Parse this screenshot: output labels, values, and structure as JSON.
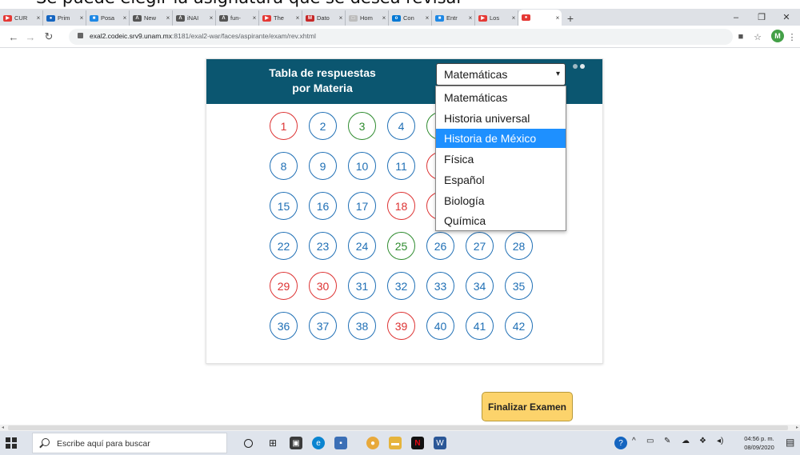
{
  "caption": {
    "bullet": "•",
    "text": "Se puede elegir la asignatura que se desea revisar"
  },
  "browser": {
    "tabs": [
      {
        "label": "CUR",
        "color": "#e53935",
        "glyph": "▶",
        "active": false
      },
      {
        "label": "Prim",
        "color": "#1565c0",
        "glyph": "●",
        "active": false
      },
      {
        "label": "Posa",
        "color": "#1e88e5",
        "glyph": "■",
        "active": false
      },
      {
        "label": "New",
        "color": "#555555",
        "glyph": "Λ",
        "active": false
      },
      {
        "label": "iNAI",
        "color": "#555555",
        "glyph": "Λ",
        "active": false
      },
      {
        "label": "fun-",
        "color": "#555555",
        "glyph": "Λ",
        "active": false
      },
      {
        "label": "The",
        "color": "#e53935",
        "glyph": "▶",
        "active": false
      },
      {
        "label": "Dato",
        "color": "#c62828",
        "glyph": "M",
        "active": false
      },
      {
        "label": "Hom",
        "color": "#bdbdbd",
        "glyph": "□",
        "active": false
      },
      {
        "label": "Con",
        "color": "#0078d4",
        "glyph": "o",
        "active": false
      },
      {
        "label": "Entr",
        "color": "#1e88e5",
        "glyph": "■",
        "active": false
      },
      {
        "label": "Los",
        "color": "#e53935",
        "glyph": "▶",
        "active": false
      },
      {
        "label": "",
        "color": "#e53935",
        "glyph": "●",
        "active": true
      }
    ],
    "tab_close": "×",
    "new_tab": "+",
    "minimize": "–",
    "maximize": "❐",
    "close": "✕",
    "url_host": "exal2.codeic.srv9.unam.mx",
    "url_rest": ":8181/exal2-war/faces/aspirante/exam/rev.xhtml",
    "profile_initial": "M"
  },
  "exam": {
    "title_line1": "Tabla de respuestas",
    "title_line2": "por Materia",
    "selected_subject": "Matemáticas",
    "dropdown_options": [
      "Matemáticas",
      "Historia universal",
      "Historia de México",
      "Física",
      "Español",
      "Biología",
      "Química"
    ],
    "highlighted_option_index": 2,
    "questions": [
      {
        "n": "1",
        "status": "red"
      },
      {
        "n": "2",
        "status": "blue"
      },
      {
        "n": "3",
        "status": "green"
      },
      {
        "n": "4",
        "status": "blue"
      },
      {
        "n": "8",
        "status": "blue"
      },
      {
        "n": "9",
        "status": "blue"
      },
      {
        "n": "10",
        "status": "blue"
      },
      {
        "n": "11",
        "status": "blue"
      },
      {
        "n": "15",
        "status": "blue"
      },
      {
        "n": "16",
        "status": "blue"
      },
      {
        "n": "17",
        "status": "blue"
      },
      {
        "n": "18",
        "status": "red"
      },
      {
        "n": "22",
        "status": "blue"
      },
      {
        "n": "23",
        "status": "blue"
      },
      {
        "n": "24",
        "status": "blue"
      },
      {
        "n": "25",
        "status": "green"
      },
      {
        "n": "26",
        "status": "blue"
      },
      {
        "n": "27",
        "status": "blue"
      },
      {
        "n": "28",
        "status": "blue"
      },
      {
        "n": "29",
        "status": "red"
      },
      {
        "n": "30",
        "status": "red"
      },
      {
        "n": "31",
        "status": "blue"
      },
      {
        "n": "32",
        "status": "blue"
      },
      {
        "n": "33",
        "status": "blue"
      },
      {
        "n": "34",
        "status": "blue"
      },
      {
        "n": "35",
        "status": "blue"
      },
      {
        "n": "36",
        "status": "blue"
      },
      {
        "n": "37",
        "status": "blue"
      },
      {
        "n": "38",
        "status": "blue"
      },
      {
        "n": "39",
        "status": "red"
      },
      {
        "n": "40",
        "status": "blue"
      },
      {
        "n": "41",
        "status": "blue"
      },
      {
        "n": "42",
        "status": "blue"
      }
    ],
    "finish_label": "Finalizar Examen",
    "colors": {
      "header": "#0b5670",
      "answered": "#1f6fb5",
      "wrong": "#d33333",
      "correct": "#2e8b2e",
      "finish": "#fcd36b"
    }
  },
  "taskbar": {
    "search_placeholder": "Escribe aquí para buscar",
    "time": "04:56 p. m.",
    "date": "08/09/2020"
  }
}
